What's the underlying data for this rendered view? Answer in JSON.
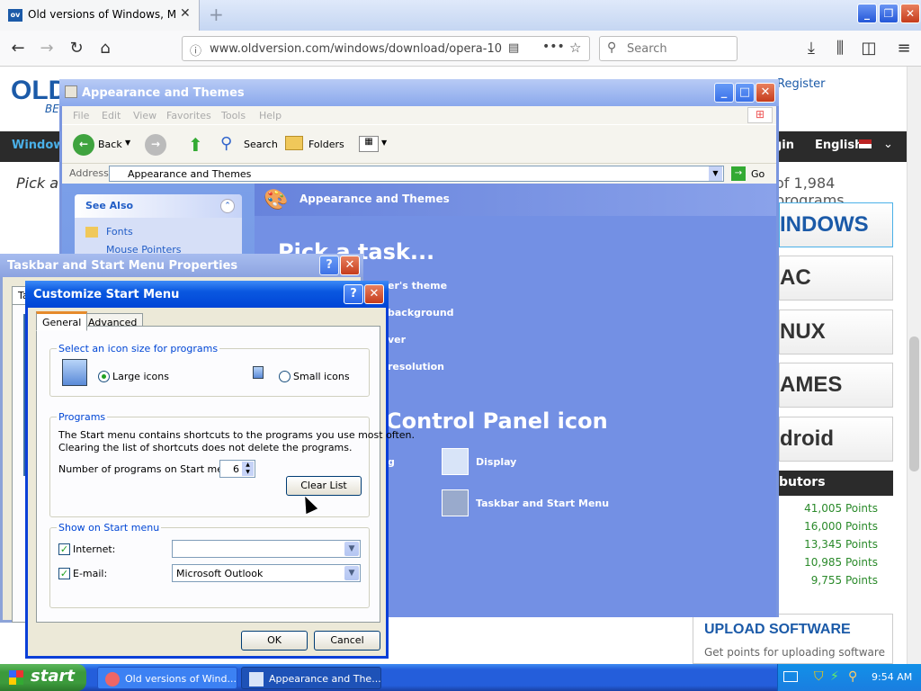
{
  "firefox": {
    "tab_title": "Old versions of Windows, Mac and",
    "favicon_text": "ov",
    "url": "www.oldversion.com/windows/download/opera-10",
    "search_placeholder": "Search"
  },
  "site": {
    "logo": "OLD",
    "slogan": "BE",
    "register": "Register",
    "nav_left": "Windows",
    "nav_login": "gin",
    "nav_lang": "English",
    "pick_text": "Pick a",
    "program_count": "of 1,984 programs",
    "os_buttons": [
      "INDOWS",
      "AC",
      "NUX",
      "AMES",
      "droid"
    ],
    "contributors_header": "butors",
    "points": [
      "41,005 Points",
      "16,000 Points",
      "13,345 Points",
      "10,985 Points",
      "9,755 Points"
    ],
    "upload_title": "UPLOAD SOFTWARE",
    "upload_sub": "Get points for uploading software"
  },
  "explorer": {
    "title": "Appearance and Themes",
    "menu": [
      "File",
      "Edit",
      "View",
      "Favorites",
      "Tools",
      "Help"
    ],
    "toolbar": {
      "back": "Back",
      "search": "Search",
      "folders": "Folders"
    },
    "address_label": "Address",
    "address_value": "Appearance and Themes",
    "go": "Go",
    "see_also_title": "See Also",
    "see_also_items": [
      "Fonts",
      "Mouse Pointers"
    ],
    "header": "Appearance and Themes",
    "pick_task": "Pick a task...",
    "tasks": [
      "er's theme",
      "background",
      "ver",
      "resolution"
    ],
    "or_pick": "Control Panel icon",
    "icons": [
      "g",
      "Display",
      "Taskbar and Start Menu"
    ]
  },
  "taskbar_props": {
    "title": "Taskbar and Start Menu Properties",
    "tab_stub": "Ta"
  },
  "customize": {
    "title": "Customize Start Menu",
    "tabs": [
      "General",
      "Advanced"
    ],
    "icon_group_label": "Select an icon size for programs",
    "large_icons": "Large icons",
    "small_icons": "Small icons",
    "programs_label": "Programs",
    "programs_desc_1": "The Start menu contains shortcuts to the programs you use most often.",
    "programs_desc_2": "Clearing the list of shortcuts does not delete the programs.",
    "num_programs_label": "Number of programs on Start menu:",
    "num_programs_value": "6",
    "clear_list": "Clear List",
    "show_label": "Show on Start menu",
    "internet_label": "Internet:",
    "internet_value": "",
    "email_label": "E-mail:",
    "email_value": "Microsoft Outlook",
    "ok": "OK",
    "cancel": "Cancel"
  },
  "taskbar": {
    "start": "start",
    "items": [
      "Old versions of Wind...",
      "Appearance and The..."
    ],
    "clock": "9:54 AM"
  }
}
